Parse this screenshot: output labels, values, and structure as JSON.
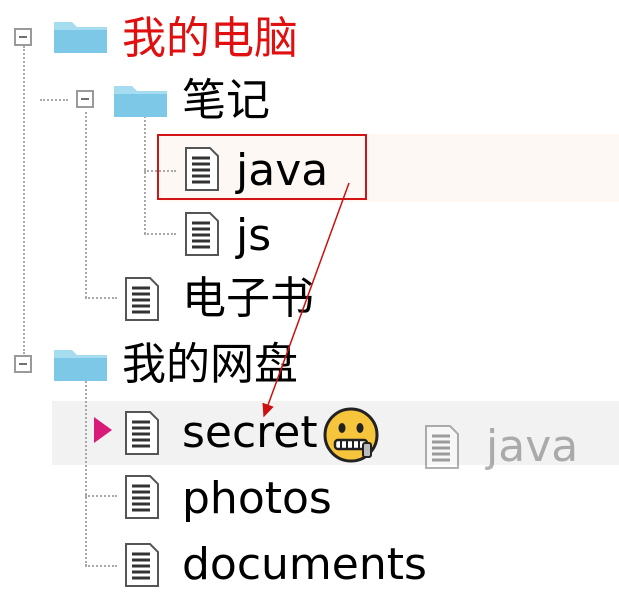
{
  "tree": {
    "root1": {
      "label": "我的电脑",
      "label_color": "#e01010",
      "icon": "folder-icon",
      "expanded": true
    },
    "notes": {
      "label": "笔记",
      "icon": "folder-icon",
      "expanded": true
    },
    "java": {
      "label": "java",
      "icon": "file-icon",
      "selected_for_drag": true
    },
    "js": {
      "label": "js",
      "icon": "file-icon"
    },
    "ebook": {
      "label": "电子书",
      "icon": "file-icon"
    },
    "root2": {
      "label": "我的网盘",
      "icon": "folder-icon",
      "expanded": true
    },
    "secret": {
      "label": "secret",
      "icon": "file-icon",
      "emoji": "zipper-mouth-face-icon",
      "drop_target": true
    },
    "photos": {
      "label": "photos",
      "icon": "file-icon"
    },
    "documents": {
      "label": "documents",
      "icon": "file-icon"
    }
  },
  "drag_ghost": {
    "label": "java",
    "icon": "file-icon"
  },
  "colors": {
    "folder": "#7cc8e6",
    "folder_light": "#a6dcf0",
    "drag_border": "#d21414",
    "drop_marker": "#d81b78",
    "connector": "#a9a9a9"
  }
}
